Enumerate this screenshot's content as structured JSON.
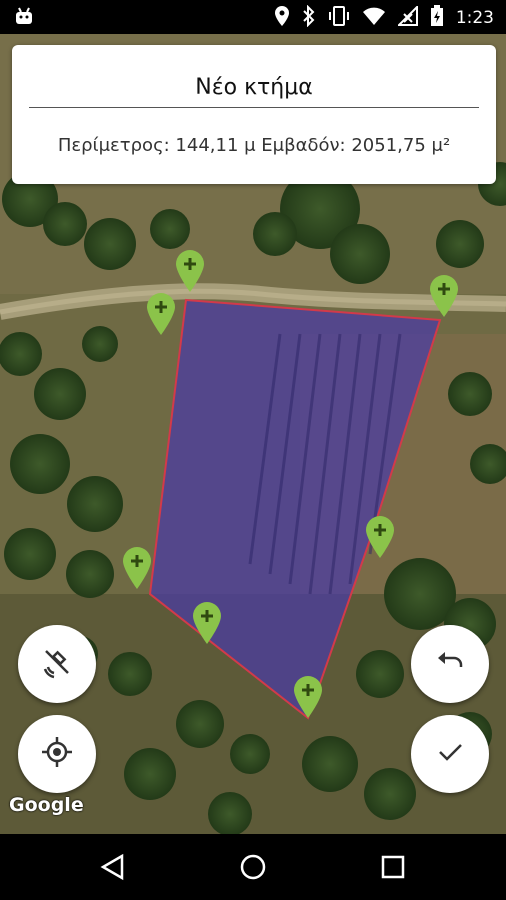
{
  "status_bar": {
    "time": "1:23",
    "icons": [
      "android-icon",
      "location-icon",
      "bluetooth-icon",
      "vibrate-icon",
      "wifi-icon",
      "no-signal-icon",
      "battery-charging-icon"
    ]
  },
  "card": {
    "title": "Νέο κτήμα",
    "stats": "Περίμετρος: 144,11 μ Εμβαδόν: 2051,75 μ²"
  },
  "map": {
    "attribution": "Google",
    "polygon_fill": "#4a3aa6",
    "polygon_stroke": "#d23a4a",
    "marker_color": "#8bc34a"
  },
  "fabs": {
    "left_top_icon": "satellite-off-icon",
    "left_bottom_icon": "my-location-icon",
    "right_top_icon": "undo-icon",
    "right_bottom_icon": "check-icon"
  },
  "nav_bar": {
    "icons": [
      "back-icon",
      "home-icon",
      "recents-icon"
    ]
  }
}
